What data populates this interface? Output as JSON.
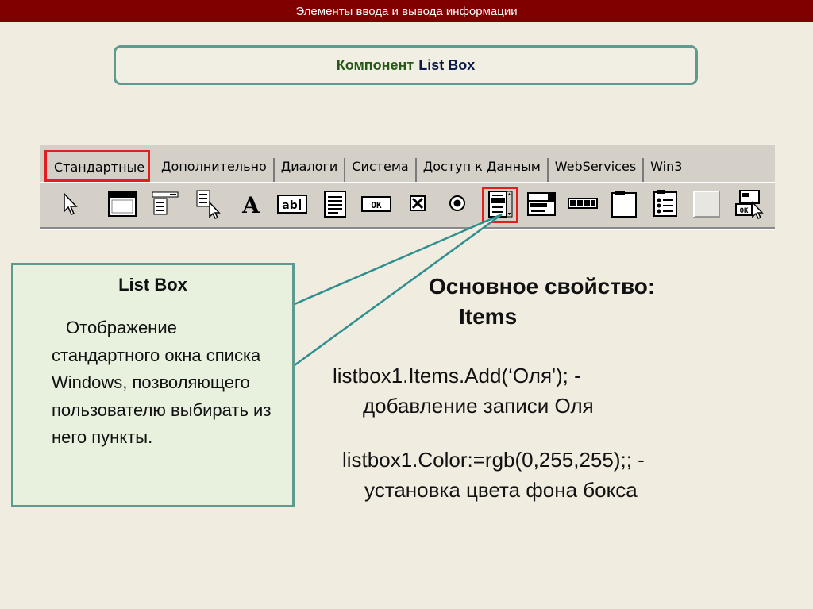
{
  "header": {
    "title": "Элементы ввода и вывода информации"
  },
  "slide": {
    "title_part1": "Компонент",
    "title_part2": "List Box"
  },
  "palette": {
    "tabs": [
      {
        "label": "Стандартные",
        "active": true
      },
      {
        "label": "Дополнительно",
        "active": false
      },
      {
        "label": "Диалоги",
        "active": false
      },
      {
        "label": "Система",
        "active": false
      },
      {
        "label": "Доступ к Данным",
        "active": false
      },
      {
        "label": "WebServices",
        "active": false
      },
      {
        "label": "Win3",
        "active": false
      }
    ],
    "tools": [
      "pointer-icon",
      "frame-icon",
      "main-menu-icon",
      "popup-menu-icon",
      "label-icon",
      "edit-icon",
      "memo-icon",
      "button-icon",
      "checkbox-icon",
      "radiobutton-icon",
      "listbox-icon",
      "combobox-icon",
      "scrollbar-icon",
      "groupbox-icon",
      "radiogroup-icon",
      "panel-icon",
      "actionlist-icon"
    ],
    "highlight_color": "#e31e1e"
  },
  "callout": {
    "title": "List Box",
    "text": "Отображение стандартного окна списка Windows, позволяющего пользователю выбирать из него пункты."
  },
  "main_property": {
    "heading": "Основное свойство:",
    "value": "Items"
  },
  "examples": [
    {
      "code": "listbox1.Items.Add(‘Оля'); -",
      "description": "добавление записи Оля"
    },
    {
      "code": "listbox1.Color:=rgb(0,255,255);; -",
      "description": "установка цвета фона бокса"
    }
  ],
  "colors": {
    "header_bg": "#800000",
    "frame_border": "#5e9a90",
    "callout_bg": "#e7f1de",
    "slide_bg": "#f0ece0"
  }
}
